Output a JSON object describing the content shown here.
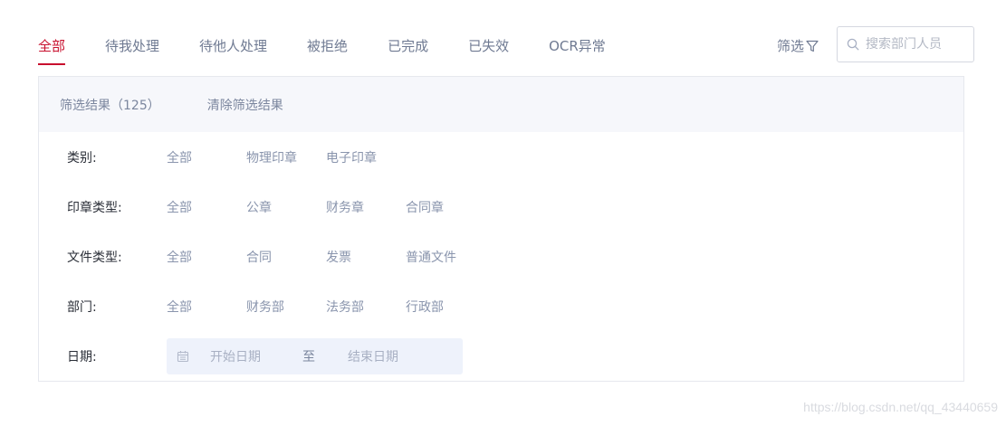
{
  "tabs": [
    {
      "label": "全部",
      "active": true
    },
    {
      "label": "待我处理",
      "active": false
    },
    {
      "label": "待他人处理",
      "active": false
    },
    {
      "label": "被拒绝",
      "active": false
    },
    {
      "label": "已完成",
      "active": false
    },
    {
      "label": "已失效",
      "active": false
    },
    {
      "label": "OCR异常",
      "active": false
    }
  ],
  "filter_toggle": {
    "label": "筛选",
    "icon": "funnel-icon"
  },
  "search": {
    "placeholder": "搜索部门人员",
    "value": "",
    "icon": "search-icon"
  },
  "filter_panel": {
    "result_count": "筛选结果（125）",
    "clear_label": "清除筛选结果",
    "rows": [
      {
        "label": "类别:",
        "options": [
          "全部",
          "物理印章",
          "电子印章"
        ]
      },
      {
        "label": "印章类型:",
        "options": [
          "全部",
          "公章",
          "财务章",
          "合同章"
        ]
      },
      {
        "label": "文件类型:",
        "options": [
          "全部",
          "合同",
          "发票",
          "普通文件"
        ]
      },
      {
        "label": "部门:",
        "options": [
          "全部",
          "财务部",
          "法务部",
          "行政部"
        ]
      }
    ],
    "date": {
      "label": "日期:",
      "icon": "calendar-icon",
      "start_placeholder": "开始日期",
      "separator": "至",
      "end_placeholder": "结束日期"
    }
  },
  "watermark": "https://blog.csdn.net/qq_43440659",
  "colors": {
    "accent": "#c8102e",
    "muted_text": "#7b869e",
    "panel_header_bg": "#f6f7fb",
    "date_bg": "#eef2fb"
  }
}
